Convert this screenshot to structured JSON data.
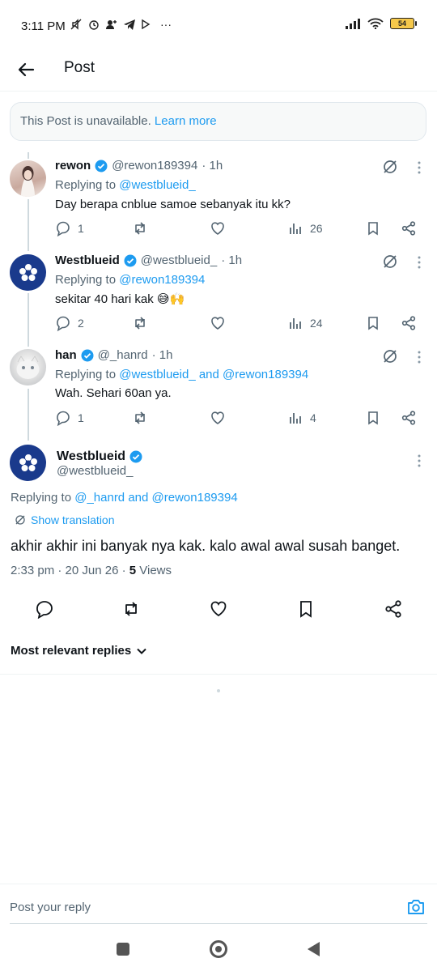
{
  "status_bar": {
    "time": "3:11 PM",
    "battery": "54",
    "more": "···"
  },
  "header": {
    "title": "Post"
  },
  "banner": {
    "text": "This Post is unavailable.",
    "link": "Learn more"
  },
  "replies": [
    {
      "name": "rewon",
      "handle": "@rewon189394",
      "time": "· 1h",
      "replying_label": "Replying to ",
      "replying_to": "@westblueid_",
      "replying_and": "",
      "replying_to2": "",
      "text": "Day berapa cnblue samoe sebanyak itu kk?",
      "reply_count": "1",
      "views": "26"
    },
    {
      "name": "Westblueid",
      "handle": "@westblueid_",
      "time": "· 1h",
      "replying_label": "Replying to ",
      "replying_to": "@rewon189394",
      "replying_and": "",
      "replying_to2": "",
      "text": "sekitar 40 hari kak 😅🙌",
      "reply_count": "2",
      "views": "24"
    },
    {
      "name": "han",
      "handle": "@_hanrd",
      "time": "· 1h",
      "replying_label": "Replying to ",
      "replying_to": "@westblueid_",
      "replying_and": " and ",
      "replying_to2": "@rewon189394",
      "text": "Wah. Sehari 60an ya.",
      "reply_count": "1",
      "views": "4"
    }
  ],
  "main_post": {
    "name": "Westblueid",
    "handle": "@westblueid_",
    "replying_label": "Replying to ",
    "replying_to": "@_hanrd",
    "replying_and": " and ",
    "replying_to2": "@rewon189394",
    "show_translation": "Show translation",
    "text": "akhir akhir ini banyak nya kak. kalo awal awal susah banget.",
    "timestamp": "2:33 pm · 20 Jun 26 · ",
    "views_count": "5",
    "views_label": " Views"
  },
  "sort": {
    "label": "Most relevant replies"
  },
  "composer": {
    "placeholder": "Post your reply"
  },
  "colors": {
    "accent": "#1d9bf0",
    "text": "#0f1419",
    "muted": "#536471",
    "westblue_avatar": "#1a3a8c"
  }
}
